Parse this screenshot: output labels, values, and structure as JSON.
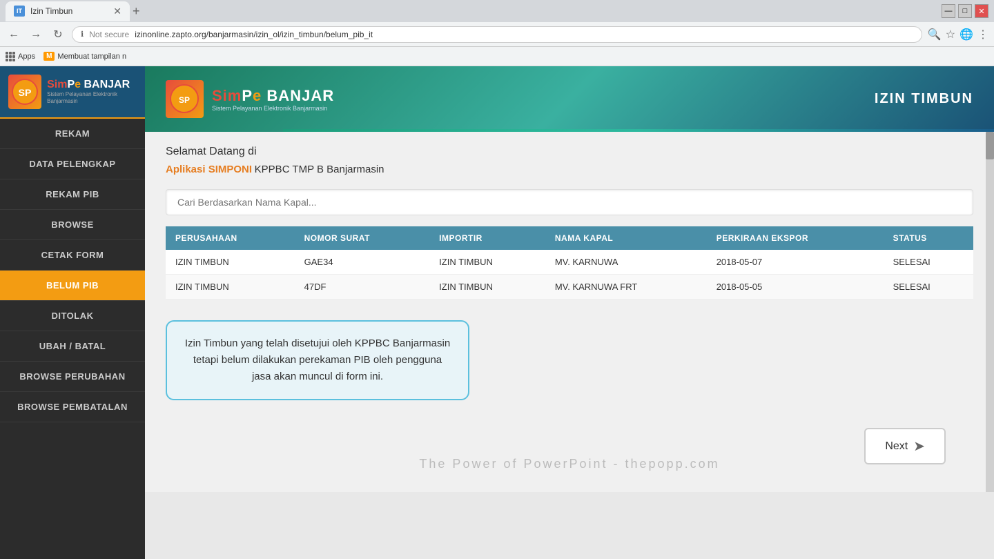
{
  "browser": {
    "tab_title": "Izin Timbun",
    "url": "izinonline.zapto.org/banjarmasin/izin_ol/izin_timbun/belum_pib_it",
    "not_secure_label": "Not secure",
    "bookmarks": {
      "apps_label": "Apps",
      "second_bookmark": "Membuat tampilan n"
    }
  },
  "header": {
    "brand_title": "SimPe BANJAR",
    "brand_sub": "Sistem Pelayanan Elektronik Banjarmasin",
    "page_title": "IZIN TIMBUN"
  },
  "sidebar": {
    "items": [
      {
        "label": "REKAM",
        "active": false
      },
      {
        "label": "DATA PELENGKAP",
        "active": false
      },
      {
        "label": "REKAM PIB",
        "active": false
      },
      {
        "label": "BROWSE",
        "active": false
      },
      {
        "label": "CETAK FORM",
        "active": false
      },
      {
        "label": "BELUM PIB",
        "active": true
      },
      {
        "label": "DITOLAK",
        "active": false
      },
      {
        "label": "UBAH / BATAL",
        "active": false
      },
      {
        "label": "BROWSE PERUBAHAN",
        "active": false
      },
      {
        "label": "BROWSE PEMBATALAN",
        "active": false
      }
    ]
  },
  "welcome": {
    "greeting": "Selamat Datang di",
    "app_name": "Aplikasi SIMPONI",
    "app_rest": " KPPBC TMP B Banjarmasin"
  },
  "search": {
    "placeholder": "Cari Berdasarkan Nama Kapal..."
  },
  "table": {
    "headers": [
      "PERUSAHAAN",
      "NOMOR SURAT",
      "IMPORTIR",
      "NAMA KAPAL",
      "PERKIRAAN EKSPOR",
      "STATUS"
    ],
    "rows": [
      {
        "perusahaan": "IZIN TIMBUN",
        "nomor_surat": "GAE34",
        "importir": "IZIN TIMBUN",
        "nama_kapal": "MV. KARNUWA",
        "perkiraan_ekspor": "2018-05-07",
        "status": "SELESAI"
      },
      {
        "perusahaan": "IZIN TIMBUN",
        "nomor_surat": "47DF",
        "importir": "IZIN TIMBUN",
        "nama_kapal": "MV. KARNUWA FRT",
        "perkiraan_ekspor": "2018-05-05",
        "status": "SELESAI"
      }
    ]
  },
  "tooltip": {
    "text": "Izin Timbun yang telah disetujui oleh KPPBC Banjarmasin tetapi belum dilakukan perekaman PIB oleh pengguna jasa akan muncul di form ini."
  },
  "watermark": {
    "text": "The Power of PowerPoint - thepopp.com"
  },
  "next_button": {
    "label": "Next"
  }
}
